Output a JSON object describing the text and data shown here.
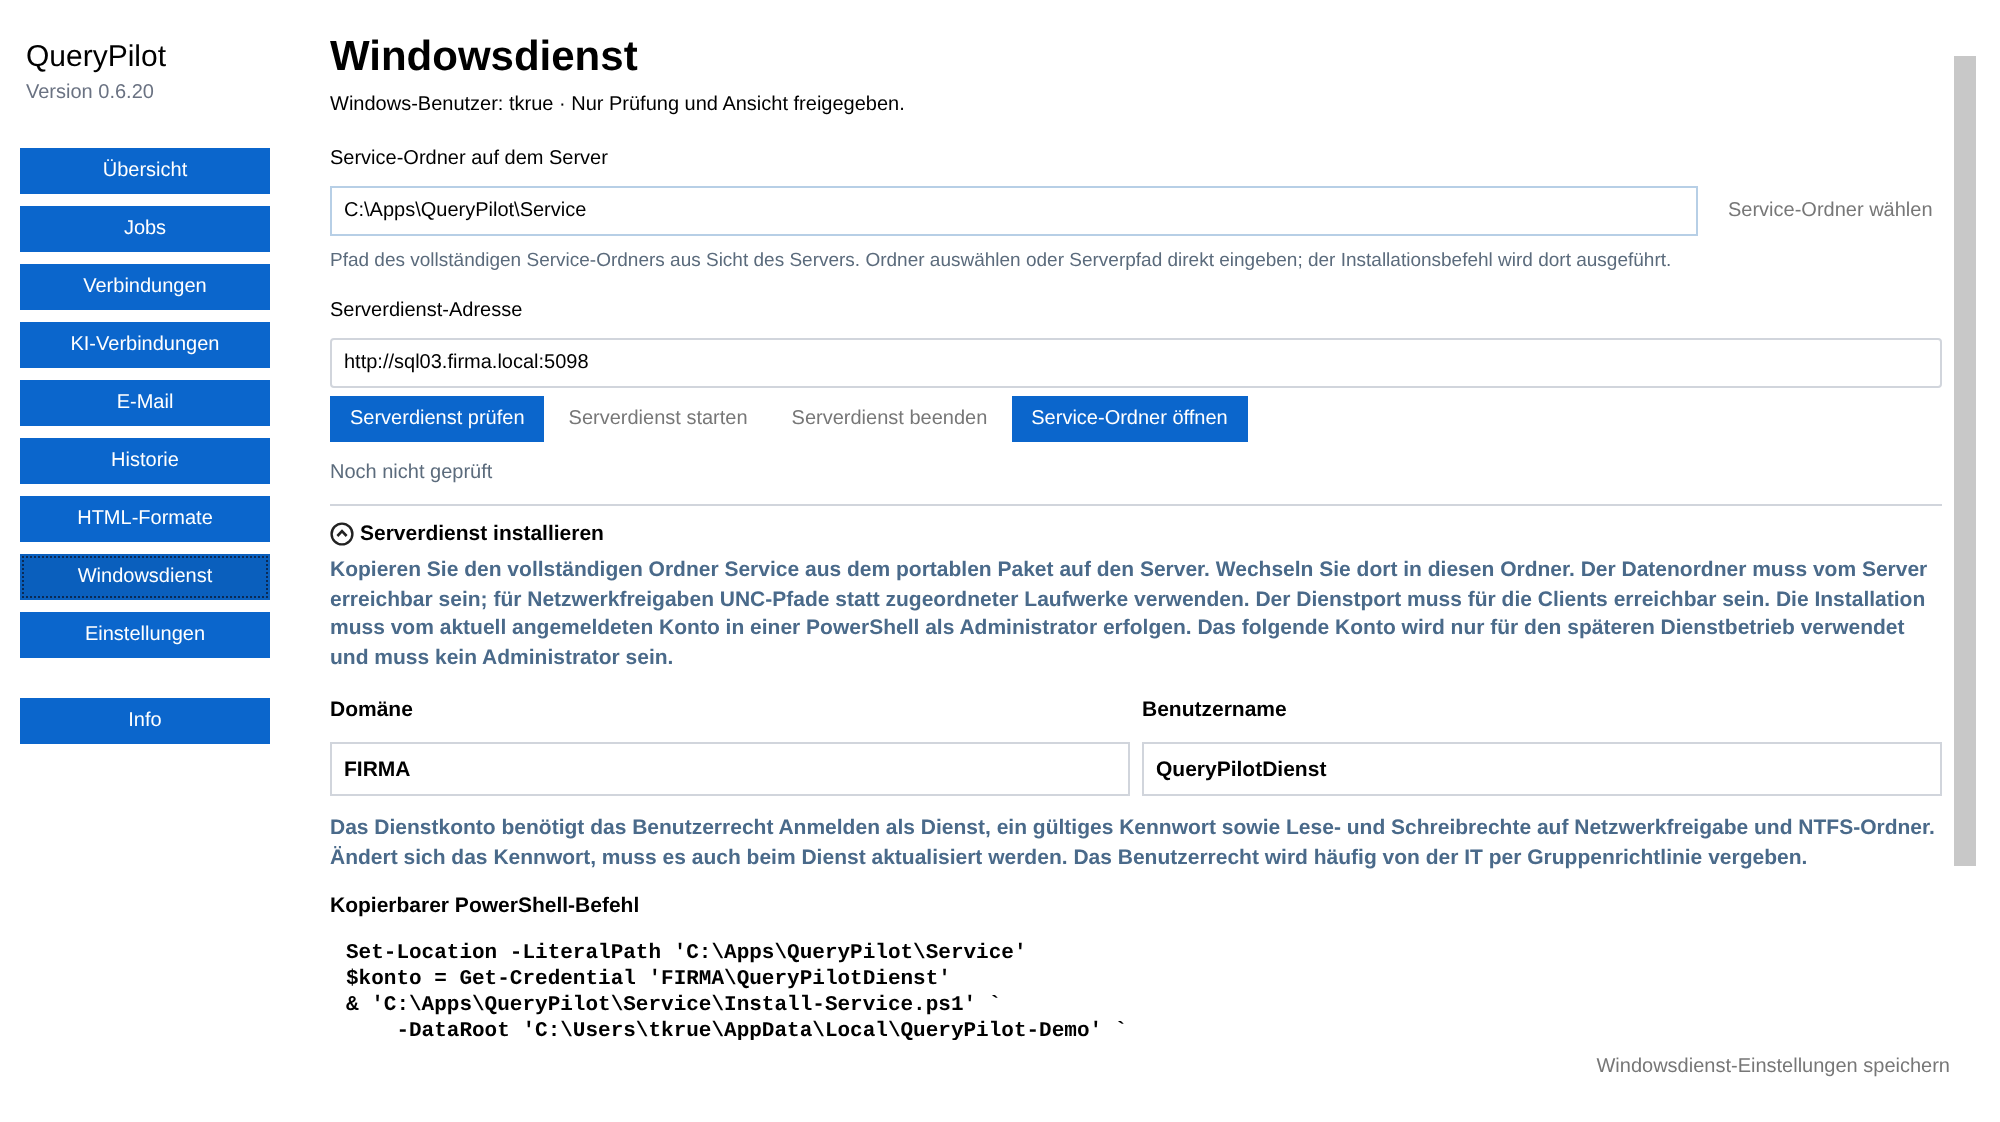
{
  "app": {
    "name": "QueryPilot",
    "version": "Version 0.6.20"
  },
  "nav": [
    {
      "label": "Übersicht",
      "selected": false
    },
    {
      "label": "Jobs",
      "selected": false
    },
    {
      "label": "Verbindungen",
      "selected": false
    },
    {
      "label": "KI-Verbindungen",
      "selected": false
    },
    {
      "label": "E-Mail",
      "selected": false
    },
    {
      "label": "Historie",
      "selected": false
    },
    {
      "label": "HTML-Formate",
      "selected": false
    },
    {
      "label": "Windowsdienst",
      "selected": true
    },
    {
      "label": "Einstellungen",
      "selected": false
    }
  ],
  "nav_info": {
    "label": "Info",
    "selected": false
  },
  "page": {
    "title": "Windowsdienst",
    "subtitle": "Windows-Benutzer: tkrue · Nur Prüfung und Ansicht freigegeben.",
    "folder": {
      "label": "Service-Ordner auf dem Server",
      "value": "C:\\Apps\\QueryPilot\\Service",
      "button": {
        "label": "Service-Ordner wählen",
        "enabled": false
      },
      "hint": "Pfad des vollständigen Service-Ordners aus Sicht des Servers. Ordner auswählen oder Serverpfad direkt eingeben; der Installationsbefehl wird dort ausgeführt."
    },
    "address": {
      "label": "Serverdienst-Adresse",
      "value": "http://sql03.firma.local:5098"
    },
    "actions": [
      {
        "label": "Serverdienst prüfen",
        "enabled": true
      },
      {
        "label": "Serverdienst starten",
        "enabled": false
      },
      {
        "label": "Serverdienst beenden",
        "enabled": false
      },
      {
        "label": "Service-Ordner öffnen",
        "enabled": true
      }
    ],
    "status": "Noch nicht geprüft",
    "install": {
      "title": "Serverdienst installieren",
      "expanded": true,
      "intro": "Kopieren Sie den vollständigen Ordner Service aus dem portablen Paket auf den Server. Wechseln Sie dort in diesen Ordner. Der Datenordner muss vom Server erreichbar sein; für Netzwerkfreigaben UNC-Pfade statt zugeordneter Laufwerke verwenden. Der Dienstport muss für die Clients erreichbar sein. Die Installation muss vom aktuell angemeldeten Konto in einer PowerShell als Administrator erfolgen. Das folgende Konto wird nur für den späteren Dienstbetrieb verwendet und muss kein Administrator sein.",
      "fields": [
        {
          "label": "Domäne",
          "value": "FIRMA"
        },
        {
          "label": "Benutzername",
          "value": "QueryPilotDienst"
        }
      ],
      "note": "Das Dienstkonto benötigt das Benutzerrecht Anmelden als Dienst, ein gültiges Kennwort sowie Lese- und Schreibrechte auf Netzwerkfreigabe und NTFS-Ordner. Ändert sich das Kennwort, muss es auch beim Dienst aktualisiert werden. Das Benutzerrecht wird häufig von der IT per Gruppenrichtlinie vergeben.",
      "code_label": "Kopierbarer PowerShell-Befehl",
      "code_lines": [
        "Set-Location -LiteralPath 'C:\\Apps\\QueryPilot\\Service'",
        "$konto = Get-Credential 'FIRMA\\QueryPilotDienst'",
        "& 'C:\\Apps\\QueryPilot\\Service\\Install-Service.ps1' `",
        "    -DataRoot 'C:\\Users\\tkrue\\AppData\\Local\\QueryPilot-Demo' `"
      ]
    }
  },
  "save": {
    "label": "Windowsdienst-Einstellungen speichern",
    "enabled": false
  }
}
